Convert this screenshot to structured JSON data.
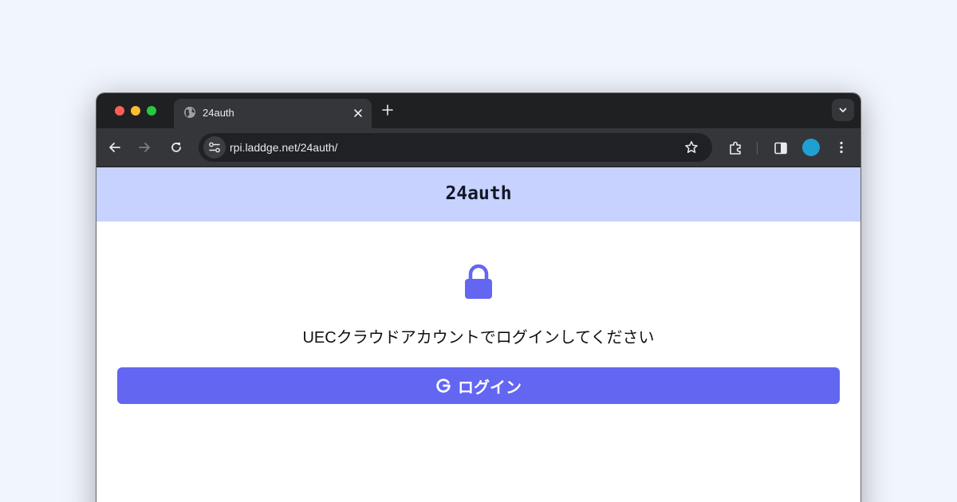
{
  "browser": {
    "tab": {
      "title": "24auth"
    },
    "address_bar": {
      "url": "rpi.laddge.net/24auth/"
    }
  },
  "site": {
    "header": {
      "title": "24auth"
    },
    "main": {
      "message": "UECクラウドアカウントでログインしてください",
      "login_button": {
        "label": "ログイン"
      }
    }
  },
  "colors": {
    "page_background": "#f1f5fd",
    "header_background": "#c7d2fe",
    "accent": "#6366f1",
    "profile_avatar": "#1fa0d4"
  },
  "icons": {
    "tab_favicon": "globe-icon",
    "tab_close": "close-icon",
    "new_tab": "plus-icon",
    "tab_search": "chevron-down-icon",
    "back": "arrow-left-icon",
    "forward": "arrow-right-icon",
    "reload": "reload-icon",
    "site_info": "tune-icon",
    "bookmark": "star-icon",
    "extensions": "puzzle-icon",
    "side_panel": "side-panel-icon",
    "menu": "kebab-menu-icon",
    "lock": "lock-icon",
    "google": "google-g-icon"
  }
}
